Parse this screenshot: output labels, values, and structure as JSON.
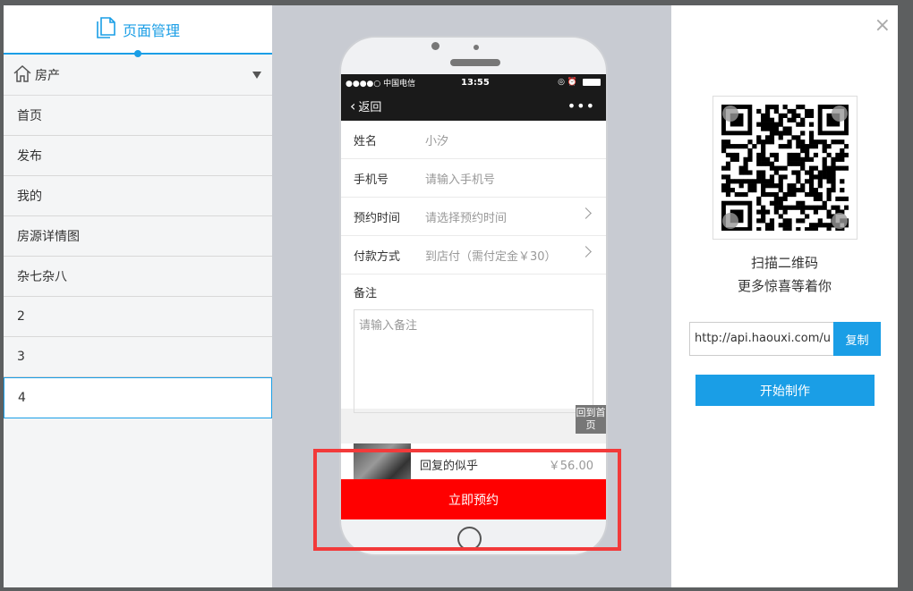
{
  "left_panel": {
    "header_title": "页面管理",
    "header_icon": "page-icon",
    "selector": {
      "icon": "home-icon",
      "label": "房产"
    },
    "pages": [
      "首页",
      "发布",
      "我的",
      "房源详情图",
      "杂七杂八",
      "2",
      "3",
      "4"
    ],
    "active_page": "4"
  },
  "phone": {
    "status": {
      "carrier": "●●●●○ 中国电信",
      "time": "13:55",
      "right": "◎ ⏰"
    },
    "nav": {
      "back_label": "返回",
      "more": "•••"
    },
    "form": [
      {
        "label": "姓名",
        "value": "小汐",
        "chevron": false
      },
      {
        "label": "手机号",
        "value": "请输入手机号",
        "chevron": false
      },
      {
        "label": "预约时间",
        "value": "请选择预约时间",
        "chevron": true
      },
      {
        "label": "付款方式",
        "value": "到店付（需付定金￥30）",
        "chevron": true
      }
    ],
    "remark": {
      "label": "备注",
      "placeholder": "请输入备注"
    },
    "back_home": "回到首页",
    "product": {
      "name": "回复的似乎",
      "price": "￥56.00"
    },
    "book_button": "立即预约"
  },
  "right_panel": {
    "qr_caption_line1": "扫描二维码",
    "qr_caption_line2": "更多惊喜等着你",
    "url": "http://api.haouxi.com/u",
    "copy_label": "复制",
    "start_label": "开始制作",
    "close": "×"
  },
  "colors": {
    "accent": "#1a9ee6",
    "book": "#ff0000",
    "highlight": "#f23a3a"
  }
}
